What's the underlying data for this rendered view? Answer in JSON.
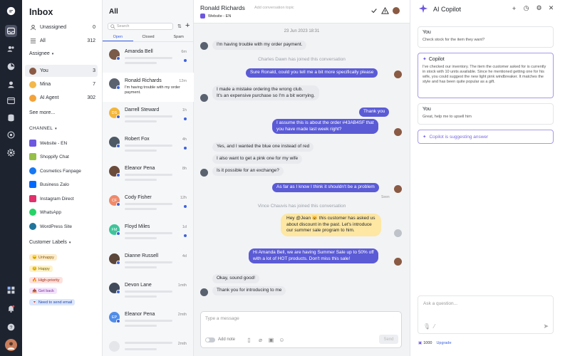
{
  "inbox": {
    "title": "Inbox",
    "rows": [
      {
        "label": "Unassigned",
        "count": "0"
      },
      {
        "label": "All",
        "count": "312"
      }
    ],
    "assignee_title": "Assignee",
    "assignees": [
      {
        "label": "You",
        "count": "3"
      },
      {
        "label": "Mina",
        "count": "7"
      },
      {
        "label": "AI Agent",
        "count": "302"
      }
    ],
    "see_more": "See more...",
    "channel_title": "CHANNEL",
    "channels": [
      {
        "label": "Website - EN",
        "color": "#6e57e0"
      },
      {
        "label": "Shoppify Chat",
        "color": "#95bf47"
      },
      {
        "label": "Cosmetics Fanpage",
        "color": "#1877f2"
      },
      {
        "label": "Business Zalo",
        "color": "#0068ff"
      },
      {
        "label": "Instagram Direct",
        "color": "#e1306c"
      },
      {
        "label": "WhatsApp",
        "color": "#25d366"
      },
      {
        "label": "WordPress Site",
        "color": "#21759b"
      }
    ],
    "labels_title": "Customer Labels",
    "labels": [
      {
        "emoji": "😠",
        "label": "Unhappy",
        "bg": "#fdeccb",
        "fg": "#8a5a00"
      },
      {
        "emoji": "😊",
        "label": "Happy",
        "bg": "#fdf2c7",
        "fg": "#7a6300"
      },
      {
        "emoji": "🔥",
        "label": "High-priority",
        "bg": "#fde1dc",
        "fg": "#a2321d"
      },
      {
        "emoji": "📤",
        "label": "Get back",
        "bg": "#f3e2fb",
        "fg": "#7b2d9a"
      },
      {
        "emoji": "💌",
        "label": "Need to send email",
        "bg": "#dbe6fd",
        "fg": "#2346a8"
      }
    ]
  },
  "list": {
    "title": "All",
    "search_placeholder": "Search",
    "tabs": [
      "Open",
      "Closed",
      "Spam"
    ],
    "conversations": [
      {
        "name": "Amanda Bell",
        "time": "6m",
        "preview": "",
        "avatar": "photo",
        "color": "#7a5a48",
        "dot": true
      },
      {
        "name": "Ronald Richards",
        "time": "12m",
        "preview": "I'm having trouble with my order payment.",
        "avatar": "photo",
        "color": "#5a6270",
        "dot": false
      },
      {
        "name": "Darrell Steward",
        "time": "1h",
        "preview": "",
        "avatar": "DS",
        "color": "#f3b63a",
        "dot": true
      },
      {
        "name": "Robert Fox",
        "time": "4h",
        "preview": "",
        "avatar": "photo",
        "color": "#4d5a66",
        "dot": true
      },
      {
        "name": "Eleanor Pena",
        "time": "8h",
        "preview": "",
        "avatar": "photo",
        "color": "#6b4c3b",
        "dot": false
      },
      {
        "name": "Cody Fisher",
        "time": "12h",
        "preview": "",
        "avatar": "CF",
        "color": "#ef8a6b",
        "dot": true
      },
      {
        "name": "Floyd Miles",
        "time": "1d",
        "preview": "",
        "avatar": "FM",
        "color": "#3cc59a",
        "dot": true
      },
      {
        "name": "Dianne Russell",
        "time": "4d",
        "preview": "",
        "avatar": "photo",
        "color": "#5b4639",
        "dot": false
      },
      {
        "name": "Devon Lane",
        "time": "1mth",
        "preview": "",
        "avatar": "photo",
        "color": "#404a59",
        "dot": false
      },
      {
        "name": "Eleanor Pena",
        "time": "2mth",
        "preview": "",
        "avatar": "EP",
        "color": "#4f8de8",
        "dot": false
      },
      {
        "name": "",
        "time": "2mth",
        "preview": "",
        "avatar": "blank",
        "color": "#e4e6ea",
        "dot": false
      }
    ]
  },
  "chat": {
    "name": "Ronald Richards",
    "topic_placeholder": "Add conversation topic",
    "channel": "Website - EN",
    "date": "23 Jun 2023 18:31",
    "sys1": "Charles Dawn has joined this conversation",
    "sys2": "Vince Chauvis has joined this conversation",
    "seen": "Seen",
    "messages": [
      {
        "text": "I'm having trouble with my order payment."
      },
      {
        "text": "Sure Ronald, could you tell me a bit more specifically please"
      },
      {
        "text": "I made a mistake ordering the wrong club.\nIt's an expensive purchase so I'm a bit worrying."
      },
      {
        "text": "Thank you"
      },
      {
        "text": "I assume this is about the order #43AB4SF that\nyou have made last week right?"
      },
      {
        "text": "Yes, and I wanted the blue one instead of red"
      },
      {
        "text": "I also want to get a pink one for my wife"
      },
      {
        "text": "Is it possible for an exchange?"
      },
      {
        "text": "As far as I know I think it shouldn't be a problem"
      },
      {
        "text": "Hey @Jean 🐱 this customer has asked us\nabout discount in the past. Let's introduce\nour summer sale program to him."
      },
      {
        "text": "Hi Amanda Bell, we are having Summer Sale up to 50% off\nwith a lot of HOT products. Don't miss this sale!"
      },
      {
        "text": "Okay, sound good!"
      },
      {
        "text": "Thank you for introducing to me"
      }
    ],
    "composer_placeholder": "Type a message",
    "add_note": "Add note",
    "send": "Send"
  },
  "copilot": {
    "title": "AI Copilot",
    "cards": [
      {
        "who": "You",
        "text": "Check stock for the item they want?"
      },
      {
        "who": "Copilot",
        "text": "I've checked our inventory. The item the customer asked for is currently in stock with 10 units available. Since he mentioned getting one for his wife, you could suggest the new light pink windbreaker. It matches the style and has been quite popular as a gift."
      },
      {
        "who": "You",
        "text": "Great, help me to upsell him"
      }
    ],
    "suggesting": "Copilot is suggesting answer",
    "ask_placeholder": "Ask a question...",
    "credits": "1000",
    "upgrade": "Upgrade"
  },
  "colors": {
    "accent": "#5b5bd6",
    "rail": "#1e2330",
    "note": "#fde7a3"
  }
}
